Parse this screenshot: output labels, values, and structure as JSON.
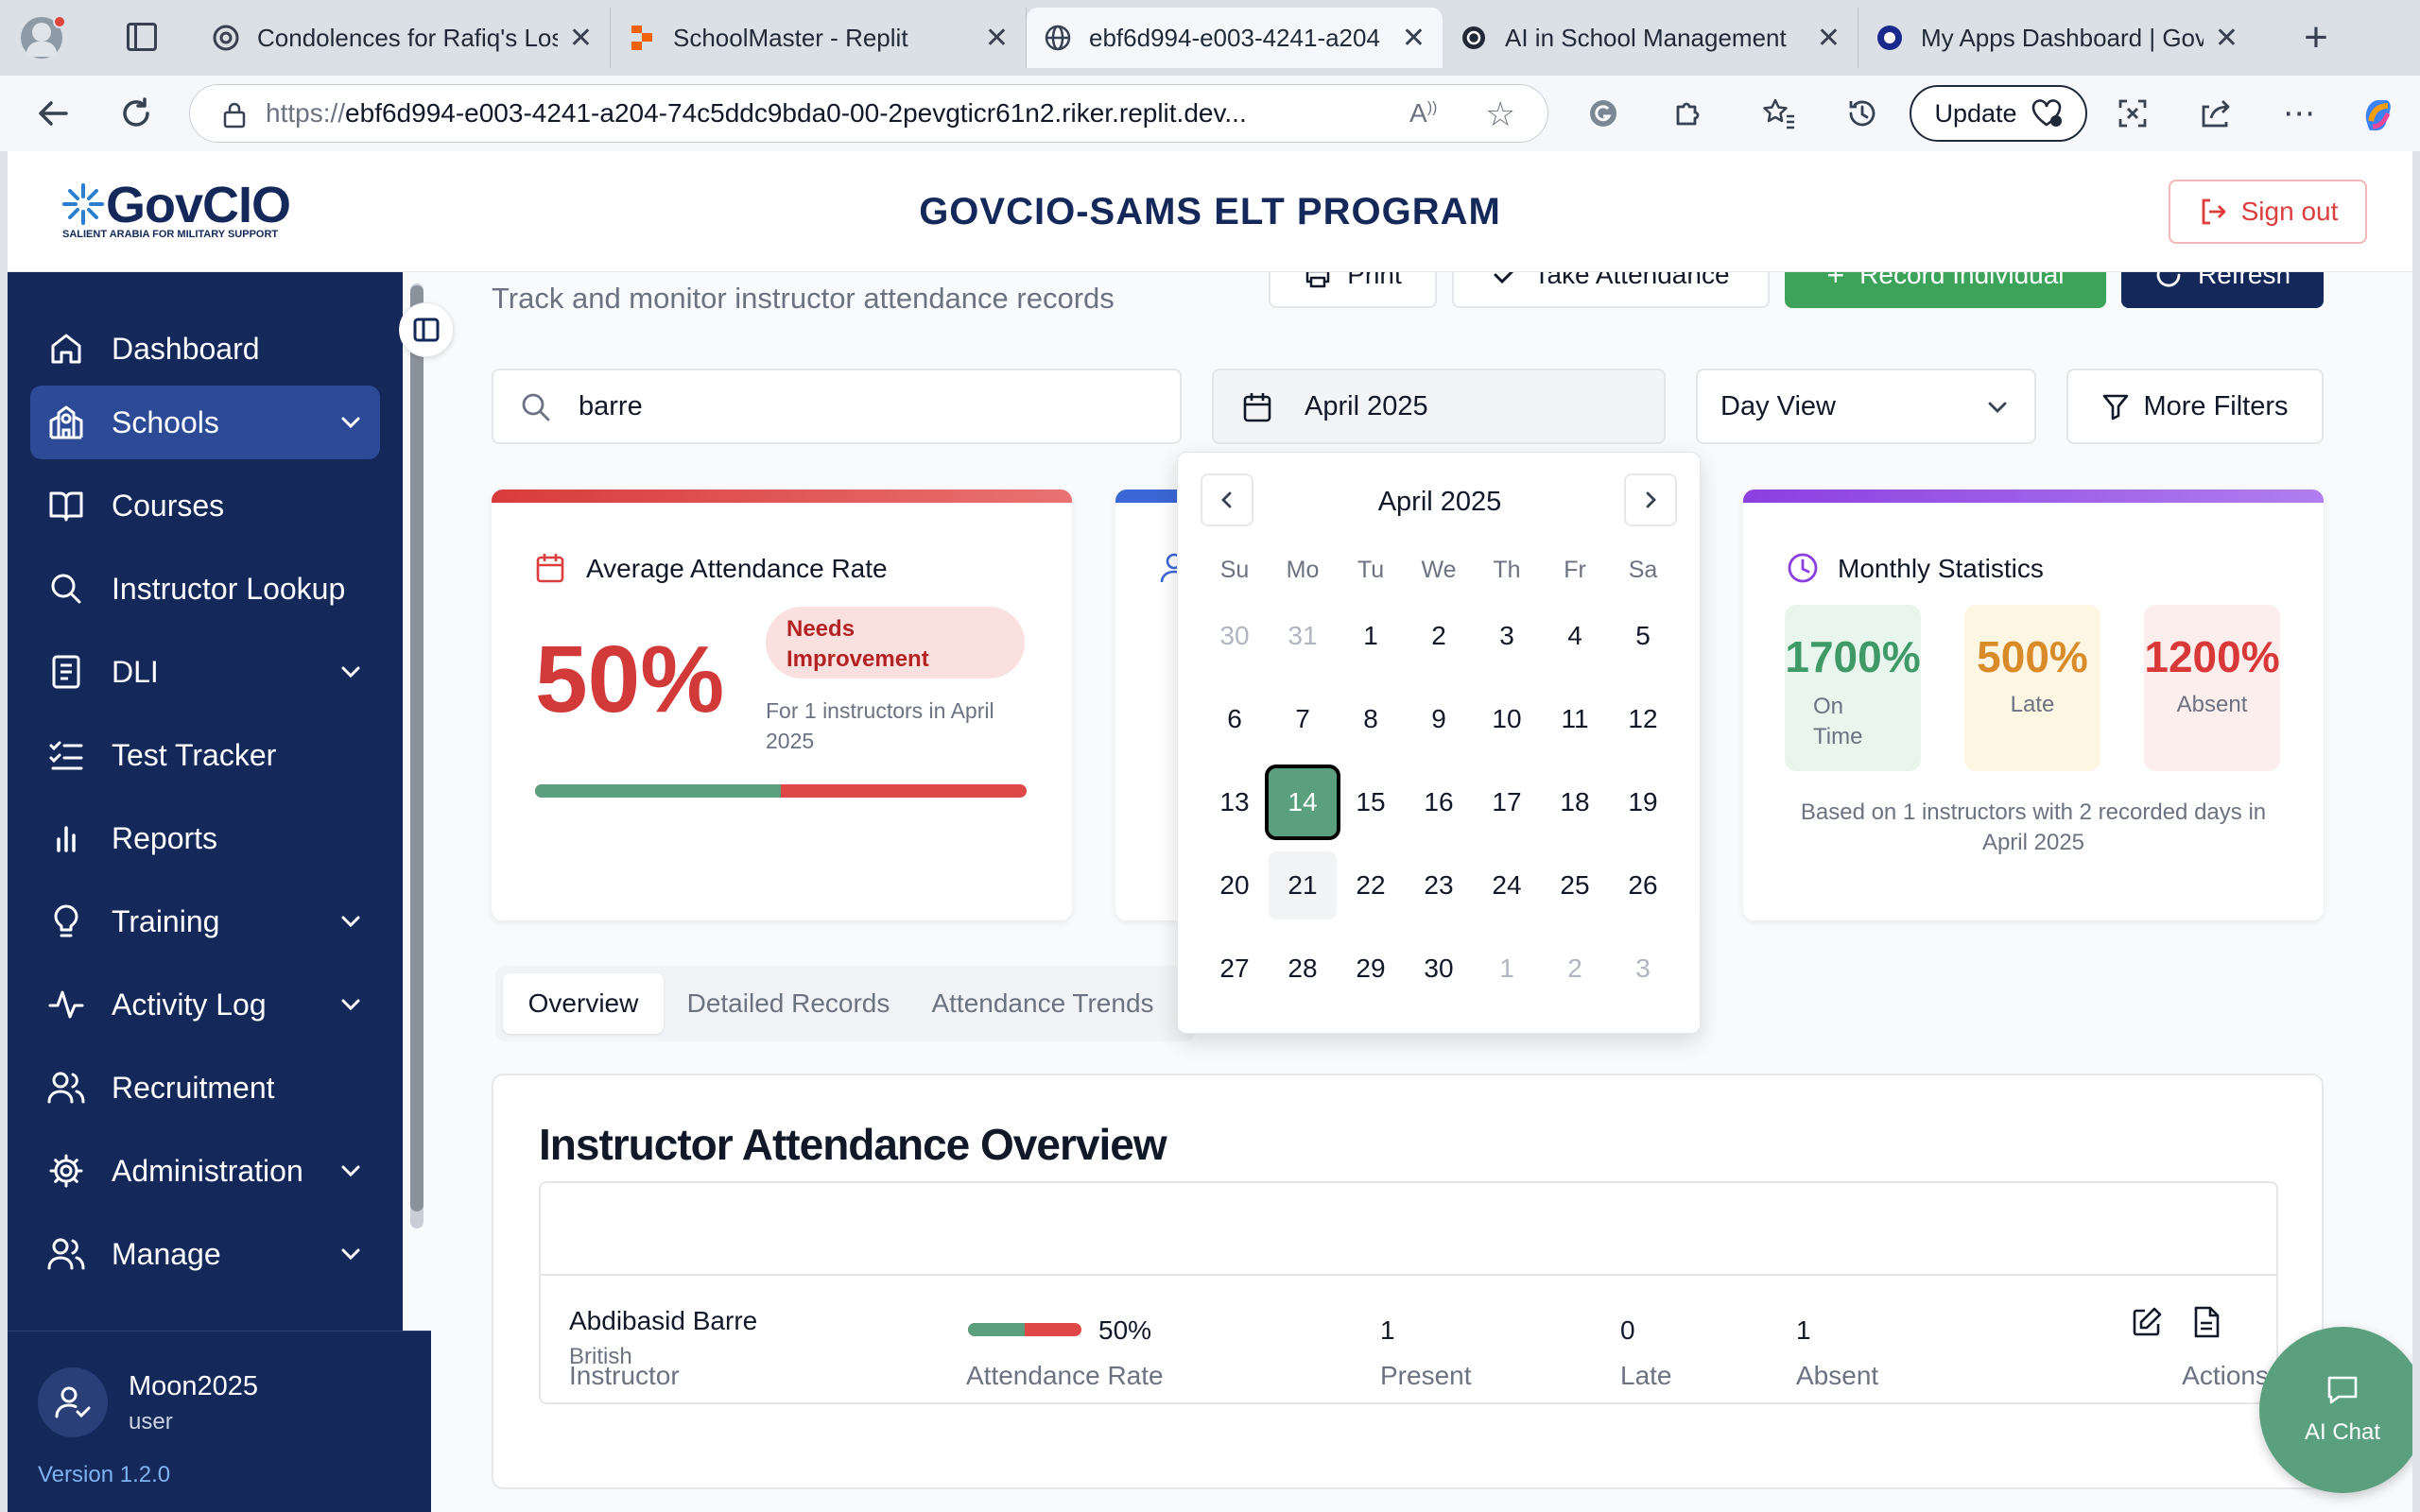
{
  "browser": {
    "tabs": [
      {
        "title": "Condolences for Rafiq's Los",
        "icon": "chatgpt-icon"
      },
      {
        "title": "SchoolMaster - Replit",
        "icon": "replit-icon"
      },
      {
        "title": "ebf6d994-e003-4241-a204",
        "icon": "globe-icon",
        "active": true
      },
      {
        "title": "AI in School Management",
        "icon": "chatgpt-icon"
      },
      {
        "title": "My Apps Dashboard | GovCI",
        "icon": "okta-icon"
      }
    ],
    "url_prefix": "https://",
    "url_domain": "ebf6d994-e003-4241-a204-74c5ddc9bda0-00-2pevgticr61n2.riker.replit.dev...",
    "update_label": "Update"
  },
  "header": {
    "logo_text": "GovCIO",
    "logo_tagline": "SALIENT ARABIA FOR MILITARY SUPPORT",
    "title": "GOVCIO-SAMS ELT PROGRAM",
    "signout_label": "Sign out"
  },
  "sidebar": {
    "items": [
      {
        "label": "Dashboard",
        "icon": "home-icon"
      },
      {
        "label": "Schools",
        "icon": "school-icon",
        "selected": true,
        "expandable": true
      },
      {
        "label": "Courses",
        "icon": "book-open-icon"
      },
      {
        "label": "Instructor Lookup",
        "icon": "search-icon"
      },
      {
        "label": "DLI",
        "icon": "notebook-icon",
        "expandable": true
      },
      {
        "label": "Test Tracker",
        "icon": "list-check-icon"
      },
      {
        "label": "Reports",
        "icon": "bar-chart-icon"
      },
      {
        "label": "Training",
        "icon": "lightbulb-icon",
        "expandable": true
      },
      {
        "label": "Activity Log",
        "icon": "activity-icon",
        "expandable": true
      },
      {
        "label": "Recruitment",
        "icon": "users-icon"
      },
      {
        "label": "Administration",
        "icon": "gear-icon",
        "expandable": true
      },
      {
        "label": "Manage",
        "icon": "users-icon",
        "expandable": true
      }
    ],
    "user": {
      "name": "Moon2025",
      "role": "user"
    },
    "version": "Version 1.2.0"
  },
  "main": {
    "subtitle": "Track and monitor instructor attendance records",
    "toolbar": {
      "print_label": "Print",
      "take_attendance_label": "Take Attendance",
      "record_individual_label": "Record Individual",
      "refresh_label": "Refresh"
    },
    "search_value": "barre",
    "month_value": "April 2025",
    "view_value": "Day View",
    "more_filters_label": "More Filters",
    "avg_card": {
      "title": "Average Attendance Rate",
      "value": "50%",
      "badge": "Needs Improvement",
      "note": "For 1 instructors in April 2025",
      "progress_fraction": 0.5
    },
    "monthly_card": {
      "title": "Monthly Statistics",
      "stats": [
        {
          "value": "1700%",
          "label": "On Time",
          "color": "#3f9a67"
        },
        {
          "value": "500%",
          "label": "Late",
          "color": "#d98b2a"
        },
        {
          "value": "1200%",
          "label": "Absent",
          "color": "#d93838"
        }
      ],
      "note": "Based on 1 instructors with 2 recorded days in April 2025"
    },
    "tabs": [
      "Overview",
      "Detailed Records",
      "Attendance Trends"
    ],
    "overview": {
      "title": "Instructor Attendance Overview",
      "columns": [
        "Instructor",
        "Attendance Rate",
        "Present",
        "Late",
        "Absent",
        "Actions"
      ],
      "rows": [
        {
          "name": "Abdibasid Barre",
          "nationality": "British",
          "rate": "50%",
          "rate_fraction": 0.5,
          "present": "1",
          "late": "0",
          "absent": "1"
        }
      ]
    }
  },
  "calendar": {
    "month_label": "April 2025",
    "weekdays": [
      "Su",
      "Mo",
      "Tu",
      "We",
      "Th",
      "Fr",
      "Sa"
    ],
    "weeks": [
      [
        "30",
        "31",
        "1",
        "2",
        "3",
        "4",
        "5"
      ],
      [
        "6",
        "7",
        "8",
        "9",
        "10",
        "11",
        "12"
      ],
      [
        "13",
        "14",
        "15",
        "16",
        "17",
        "18",
        "19"
      ],
      [
        "20",
        "21",
        "22",
        "23",
        "24",
        "25",
        "26"
      ],
      [
        "27",
        "28",
        "29",
        "30",
        "1",
        "2",
        "3"
      ]
    ],
    "selected_day": "14",
    "highlighted_day": "21"
  },
  "chat": {
    "label": "AI Chat"
  },
  "colors": {
    "navy": "#14285a",
    "sidebar_selected": "#2c4a96",
    "green": "#5aa07f",
    "red": "#dc3d3d",
    "purple": "#8b3fe0"
  }
}
